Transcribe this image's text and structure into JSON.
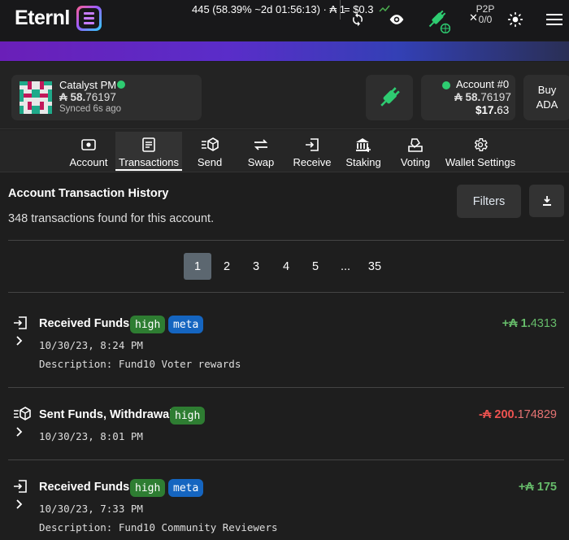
{
  "app": {
    "logo_text": "Eternl"
  },
  "topbar": {
    "p2p_label": "P2P",
    "p2p_count": "0/0"
  },
  "ticker": {
    "text": "445 (58.39% ~2d 01:56:13) · ₳ 1",
    "price": "= $0.3"
  },
  "wallet": {
    "name": "Catalyst PM",
    "balance_int": "₳ 58.",
    "balance_frac": "76197",
    "sync_status": "Synced 6s ago"
  },
  "account": {
    "name": "Account #0",
    "balance_int": "₳ 58.",
    "balance_frac": "76197",
    "fiat_int": "$17.",
    "fiat_frac": "63"
  },
  "buy": {
    "line1": "Buy",
    "line2": "ADA"
  },
  "nav": {
    "items": [
      {
        "label": "Account",
        "icon": "eye-icon"
      },
      {
        "label": "Transactions",
        "icon": "document-icon"
      },
      {
        "label": "Send",
        "icon": "send-box-icon"
      },
      {
        "label": "Swap",
        "icon": "swap-icon"
      },
      {
        "label": "Receive",
        "icon": "receive-icon"
      },
      {
        "label": "Staking",
        "icon": "bank-icon"
      },
      {
        "label": "Voting",
        "icon": "ballot-icon"
      },
      {
        "label": "Wallet Settings",
        "icon": "gear-icon"
      }
    ],
    "active": "Transactions"
  },
  "history": {
    "title": "Account Transaction History",
    "count_text": "348 transactions found for this account.",
    "filters_label": "Filters"
  },
  "pagination": {
    "pages": [
      "1",
      "2",
      "3",
      "4",
      "5",
      "...",
      "35"
    ],
    "current": "1"
  },
  "transactions": [
    {
      "title": "Received Funds",
      "badges": [
        "high",
        "meta"
      ],
      "datetime": "10/30/23, 8:24 PM",
      "description": "Description: Fund10 Voter rewards",
      "amount_sign": "+₳",
      "amount_int": "1.",
      "amount_frac": "4313",
      "direction": "in"
    },
    {
      "title": "Sent Funds, Withdrawal",
      "badges": [
        "high"
      ],
      "datetime": "10/30/23, 8:01 PM",
      "description": "",
      "amount_sign": "-₳",
      "amount_int": "200.",
      "amount_frac": "174829",
      "direction": "out"
    },
    {
      "title": "Received Funds",
      "badges": [
        "high",
        "meta"
      ],
      "datetime": "10/30/23, 7:33 PM",
      "description": "Description: Fund10 Community Reviewers",
      "amount_sign": "+₳",
      "amount_int": "175",
      "amount_frac": "",
      "direction": "in"
    }
  ],
  "colors": {
    "accent_green": "#2ecc71",
    "positive": "#66bb6a",
    "negative": "#ef5350",
    "badge_high": "#2e7d32",
    "badge_meta": "#1565c0"
  }
}
